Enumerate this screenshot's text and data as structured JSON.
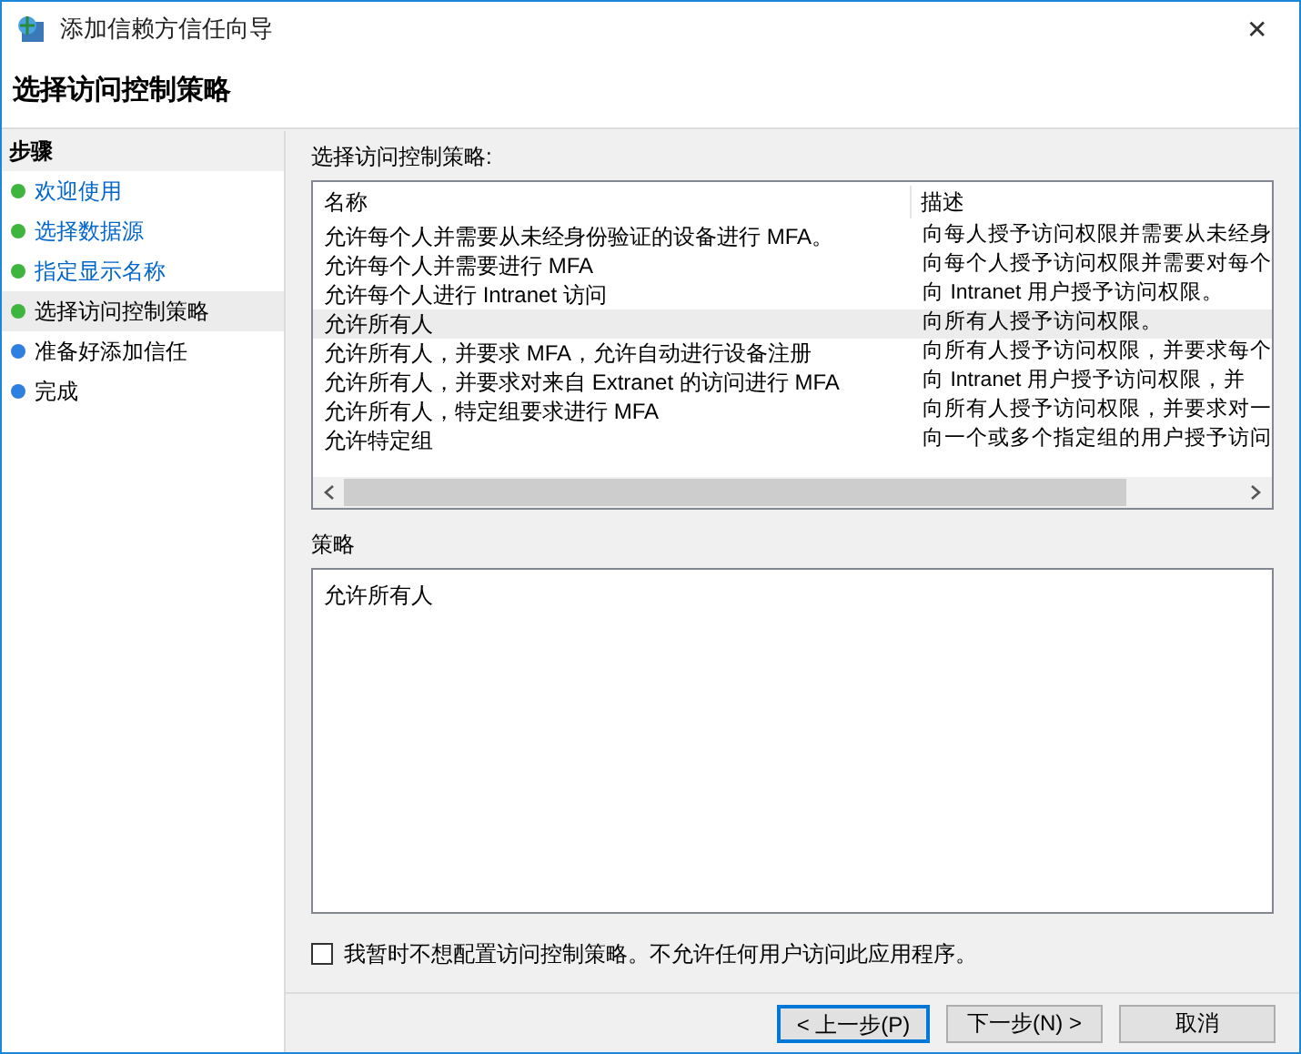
{
  "window": {
    "title": "添加信赖方信任向导",
    "close": "✕"
  },
  "page_title": "选择访问控制策略",
  "steps": {
    "heading": "步骤",
    "items": [
      {
        "label": "欢迎使用",
        "done": true,
        "selected": false
      },
      {
        "label": "选择数据源",
        "done": true,
        "selected": false
      },
      {
        "label": "指定显示名称",
        "done": true,
        "selected": false
      },
      {
        "label": "选择访问控制策略",
        "done": true,
        "selected": true
      },
      {
        "label": "准备好添加信任",
        "done": false,
        "selected": false
      },
      {
        "label": "完成",
        "done": false,
        "selected": false
      }
    ]
  },
  "policy_list": {
    "label": "选择访问控制策略:",
    "columns": [
      "名称",
      "描述"
    ],
    "rows": [
      {
        "name": "允许每个人并需要从未经身份验证的设备进行 MFA。",
        "description": "向每人授予访问权限并需要从未经身",
        "selected": false
      },
      {
        "name": "允许每个人并需要进行 MFA",
        "description": "向每个人授予访问权限并需要对每个",
        "selected": false
      },
      {
        "name": "允许每个人进行 Intranet 访问",
        "description": "向 Intranet 用户授予访问权限。",
        "selected": false
      },
      {
        "name": "允许所有人",
        "description": "向所有人授予访问权限。",
        "selected": true
      },
      {
        "name": "允许所有人，并要求 MFA，允许自动进行设备注册",
        "description": "向所有人授予访问权限，并要求每个",
        "selected": false
      },
      {
        "name": "允许所有人，并要求对来自 Extranet 的访问进行 MFA",
        "description": "向 Intranet 用户授予访问权限，并",
        "selected": false
      },
      {
        "name": "允许所有人，特定组要求进行 MFA",
        "description": "向所有人授予访问权限，并要求对一",
        "selected": false
      },
      {
        "name": "允许特定组",
        "description": "向一个或多个指定组的用户授予访问",
        "selected": false
      }
    ]
  },
  "policy": {
    "label": "策略",
    "value": "允许所有人"
  },
  "skip_checkbox": {
    "label": "我暂时不想配置访问控制策略。不允许任何用户访问此应用程序。",
    "checked": false
  },
  "buttons": [
    {
      "label": "< 上一步(P)",
      "default": true
    },
    {
      "label": "下一步(N) >",
      "default": false
    },
    {
      "label": "取消",
      "default": false
    }
  ]
}
